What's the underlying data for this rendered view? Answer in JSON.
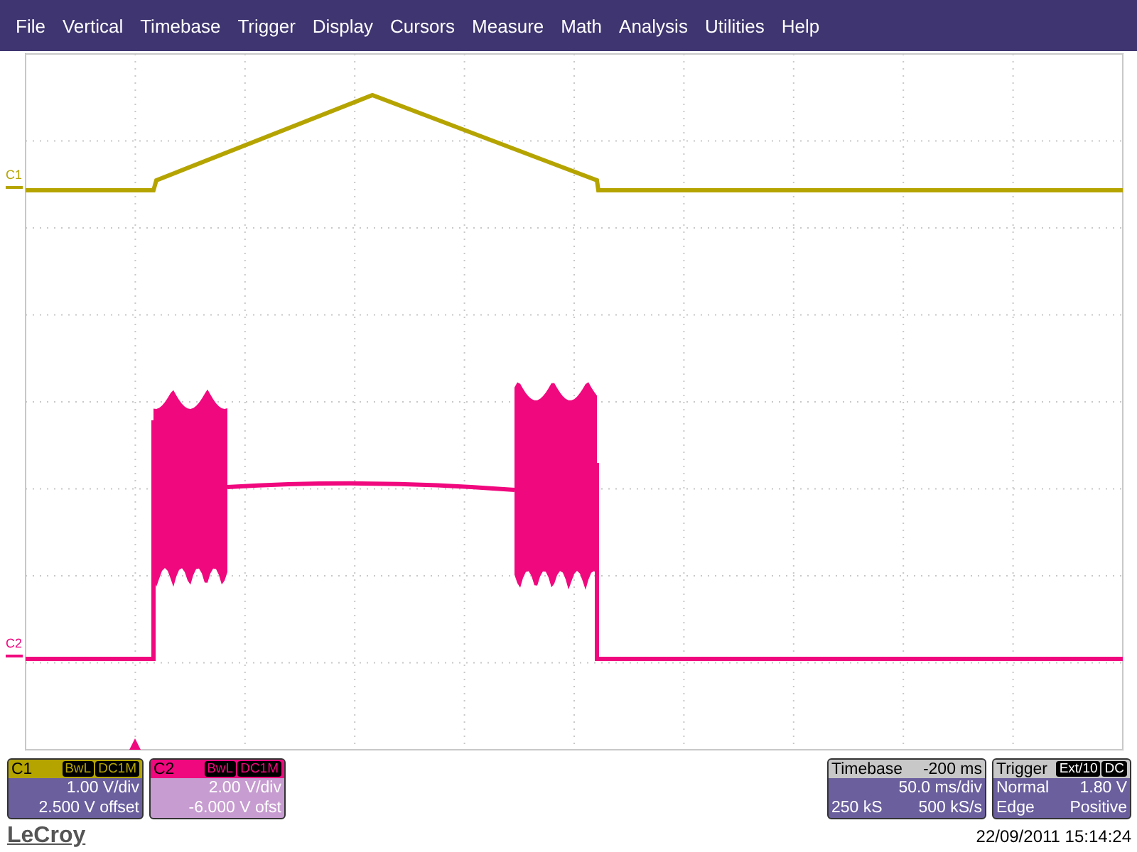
{
  "menu": [
    "File",
    "Vertical",
    "Timebase",
    "Trigger",
    "Display",
    "Cursors",
    "Measure",
    "Math",
    "Analysis",
    "Utilities",
    "Help"
  ],
  "channels": [
    {
      "label": "C1",
      "marker_label": "C1",
      "color": "#b5a400",
      "selected": true,
      "tags": [
        "BwL",
        "DC1M"
      ],
      "scale": "1.00 V/div",
      "offset": "2.500 V offset",
      "kind": "ramp"
    },
    {
      "label": "C2",
      "marker_label": "C2",
      "color": "#f0087e",
      "selected": false,
      "tags": [
        "BwL",
        "DC1M"
      ],
      "scale": "2.00 V/div",
      "offset": "-6.000 V ofst",
      "kind": "burst"
    }
  ],
  "timebase": {
    "title": "Timebase",
    "delay": "-200 ms",
    "scale": "50.0 ms/div",
    "samples": "250 kS",
    "rate": "500 kS/s"
  },
  "trigger": {
    "title": "Trigger",
    "tags": [
      "Ext/10",
      "DC"
    ],
    "mode": "Normal",
    "level": "1.80 V",
    "type": "Edge",
    "slope": "Positive"
  },
  "footer": {
    "logo": "LeCroy",
    "datetime": "22/09/2011 15:14:24"
  }
}
